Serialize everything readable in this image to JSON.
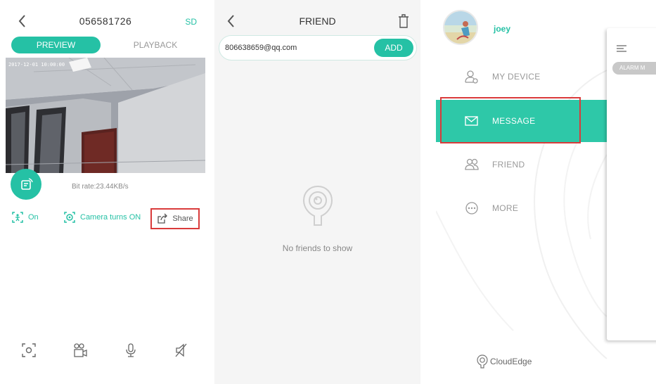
{
  "preview_screen": {
    "header": {
      "title": "056581726",
      "sd_label": "SD"
    },
    "tabs": {
      "preview": "PREVIEW",
      "playback": "PLAYBACK"
    },
    "video": {
      "timestamp": "2017-12-01 10:00:00"
    },
    "bitrate": "Bit rate:23.44KB/s",
    "controls": {
      "detection": "On",
      "camera": "Camera turns ON",
      "share": "Share"
    },
    "bottom_icons": [
      "screenshot-icon",
      "record-icon",
      "microphone-icon",
      "speaker-mute-icon"
    ],
    "accent_color": "#25c1a5",
    "highlight_color": "#d93b3b"
  },
  "friend_screen": {
    "header": {
      "title": "FRIEND"
    },
    "search": {
      "value": "806638659@qq.com"
    },
    "add_label": "ADD",
    "empty_text": "No friends to show"
  },
  "menu_screen": {
    "user": {
      "name": "joey"
    },
    "menu": [
      {
        "label": "MY DEVICE",
        "icon": "user-device-icon"
      },
      {
        "label": "MESSAGE",
        "icon": "message-icon",
        "active": true
      },
      {
        "label": "FRIEND",
        "icon": "friends-icon"
      },
      {
        "label": "MORE",
        "icon": "more-icon"
      }
    ],
    "brand": "CloudEdge",
    "side_chip": "ALARM M"
  }
}
